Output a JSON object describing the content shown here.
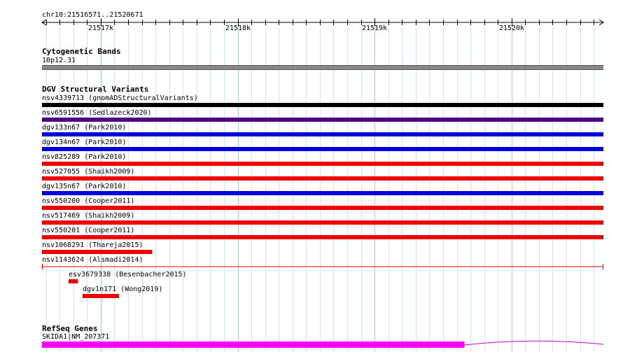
{
  "ruler": {
    "locus": "chr10:21516571..21520671",
    "ticks": [
      {
        "label": "21517k",
        "value": 21517000
      },
      {
        "label": "21518k",
        "value": 21518000
      },
      {
        "label": "21519k",
        "value": 21519000
      },
      {
        "label": "21520k",
        "value": 21520000
      }
    ],
    "start": 21516571,
    "end": 21520671
  },
  "cytoband": {
    "title": "Cytogenetic Bands",
    "band_label": "10p12.31",
    "color": "#888888"
  },
  "dgv": {
    "title": "DGV Structural Variants",
    "colors": {
      "gain_loss": "#000000",
      "complex": "#4b0082",
      "gain": "#0000dd",
      "loss": "#ee0000"
    },
    "variants": [
      {
        "label": "nsv4339713 (gnomADStructuralVariants)",
        "color": "#000000"
      },
      {
        "label": "nsv6591556 (Sedlazeck2020)",
        "color": "#4b0082"
      },
      {
        "label": "dgv133n67 (Park2010)",
        "color": "#0000dd"
      },
      {
        "label": "dgv134n67 (Park2010)",
        "color": "#0000dd"
      },
      {
        "label": "nsv825289 (Park2010)",
        "color": "#ee0000"
      },
      {
        "label": "nsv527055 (Shaikh2009)",
        "color": "#ee0000"
      },
      {
        "label": "dgv135n67 (Park2010)",
        "color": "#0000dd"
      },
      {
        "label": "nsv550200 (Cooper2011)",
        "color": "#ee0000"
      },
      {
        "label": "nsv517469 (Shaikh2009)",
        "color": "#ee0000"
      },
      {
        "label": "nsv550201 (Cooper2011)",
        "color": "#ee0000"
      },
      {
        "label": "nsv1068291 (Thareja2015)",
        "color": "#ee0000"
      },
      {
        "label": "nsv1143624 (Alsmadi2014)",
        "color": "#ee0000"
      },
      {
        "label": "esv3679338 (Besenbacher2015)",
        "color": "#ee0000"
      },
      {
        "label": "dgv1n171 (Wong2019)",
        "color": "#ee0000"
      }
    ]
  },
  "refseq": {
    "title": "RefSeq Genes",
    "gene_label": "SKIDA1|NM_207371",
    "color": "#ff00ff"
  }
}
